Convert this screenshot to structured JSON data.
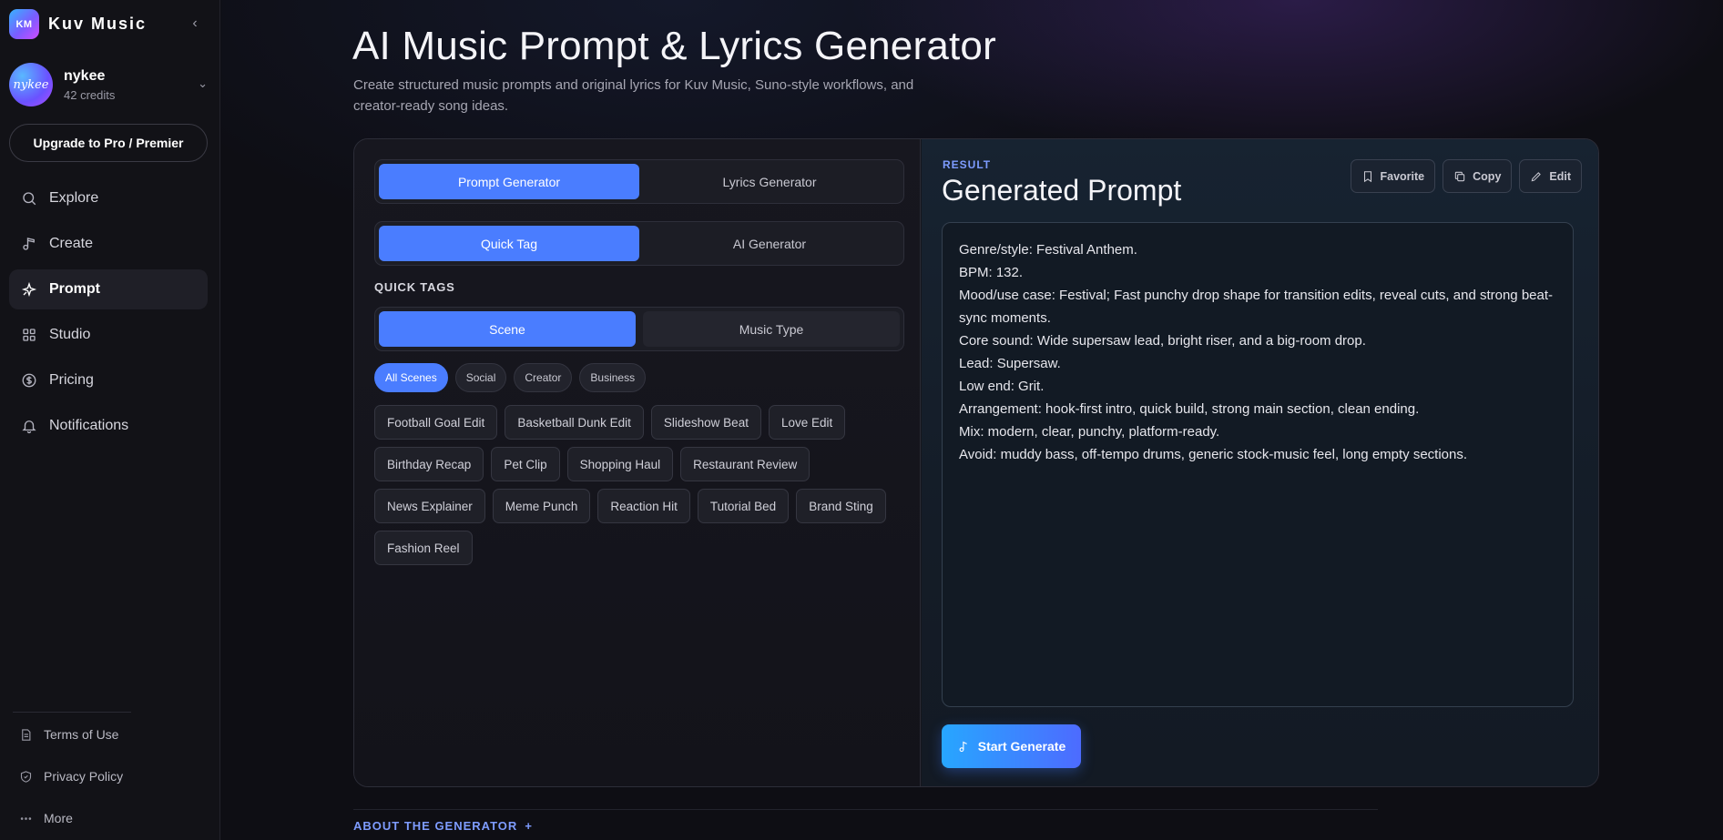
{
  "brand": {
    "logo_text": "KM",
    "name": "Kuv Music"
  },
  "user": {
    "avatar_text": "nykee",
    "name": "nykee",
    "credits": "42 credits"
  },
  "upgrade_label": "Upgrade to Pro / Premier",
  "nav": [
    {
      "label": "Explore",
      "icon": "search-icon"
    },
    {
      "label": "Create",
      "icon": "music-note-icon"
    },
    {
      "label": "Prompt",
      "icon": "sparkle-icon",
      "active": true
    },
    {
      "label": "Studio",
      "icon": "grid-icon"
    },
    {
      "label": "Pricing",
      "icon": "dollar-circle-icon"
    },
    {
      "label": "Notifications",
      "icon": "bell-icon"
    }
  ],
  "footer_nav": [
    {
      "label": "Terms of Use",
      "icon": "document-icon"
    },
    {
      "label": "Privacy Policy",
      "icon": "shield-icon"
    },
    {
      "label": "More",
      "icon": "more-icon"
    }
  ],
  "page": {
    "title": "AI Music Prompt & Lyrics Generator",
    "subtitle": "Create structured music prompts and original lyrics for Kuv Music, Suno-style workflows, and creator-ready song ideas."
  },
  "mode_tabs": [
    "Prompt Generator",
    "Lyrics Generator"
  ],
  "sub_tabs": [
    "Quick Tag",
    "AI Generator"
  ],
  "quick_tags_label": "QUICK TAGS",
  "tag_tabs": [
    "Scene",
    "Music Type"
  ],
  "filter_chips": [
    "All Scenes",
    "Social",
    "Creator",
    "Business"
  ],
  "tags": [
    "Football Goal Edit",
    "Basketball Dunk Edit",
    "Slideshow Beat",
    "Love Edit",
    "Birthday Recap",
    "Pet Clip",
    "Shopping Haul",
    "Restaurant Review",
    "News Explainer",
    "Meme Punch",
    "Reaction Hit",
    "Tutorial Bed",
    "Brand Sting",
    "Fashion Reel"
  ],
  "result": {
    "label": "RESULT",
    "title": "Generated Prompt",
    "actions": [
      "Favorite",
      "Copy",
      "Edit"
    ],
    "lines": [
      "Genre/style: Festival Anthem.",
      "BPM: 132.",
      "Mood/use case: Festival; Fast punchy drop shape for transition edits, reveal cuts, and strong beat-sync moments.",
      "Core sound: Wide supersaw lead, bright riser, and a big-room drop.",
      "Lead: Supersaw.",
      "Low end: Grit.",
      "Arrangement: hook-first intro, quick build, strong main section, clean ending.",
      "Mix: modern, clear, punchy, platform-ready.",
      "Avoid: muddy bass, off-tempo drums, generic stock-music feel, long empty sections."
    ],
    "start_label": "Start Generate"
  },
  "about_label": "ABOUT THE GENERATOR",
  "about_toggle": "+",
  "colors": {
    "accent": "#4a7dff",
    "label_blue": "#7e9cff"
  }
}
